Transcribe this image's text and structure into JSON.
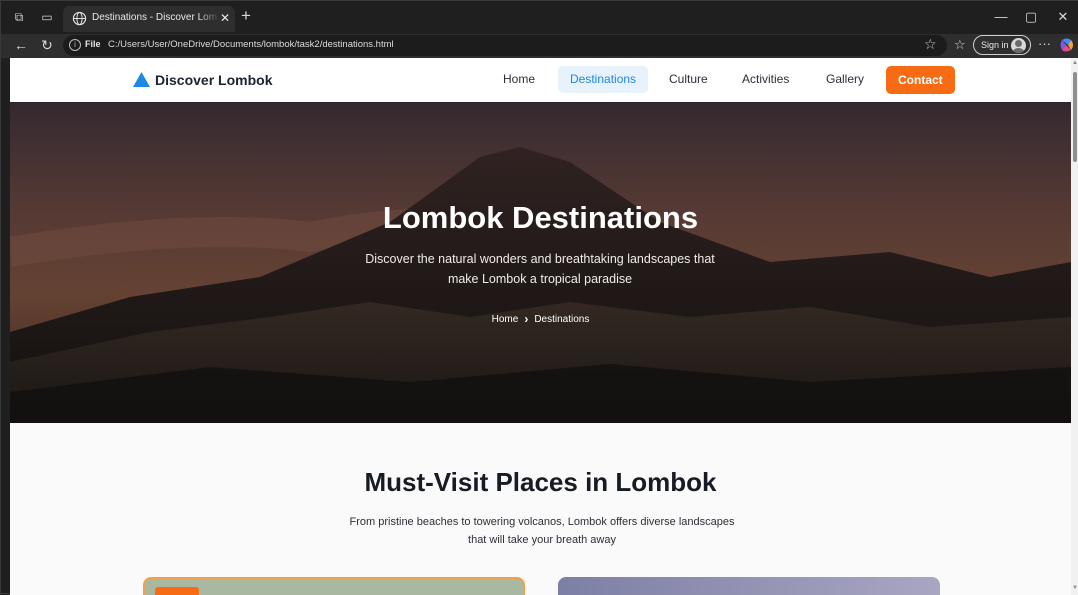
{
  "browser": {
    "tab_title": "Destinations - Discover Lombok",
    "address_scheme": "File",
    "address_url": "C:/Users/User/OneDrive/Documents/lombok/task2/destinations.html",
    "signin_label": "Sign in"
  },
  "site": {
    "brand": "Discover Lombok",
    "nav": [
      {
        "label": "Home"
      },
      {
        "label": "Destinations",
        "active": true
      },
      {
        "label": "Culture"
      },
      {
        "label": "Activities"
      },
      {
        "label": "Gallery"
      }
    ],
    "contact_label": "Contact",
    "accent_color": "#1e88e5",
    "cta_color": "#f76b15"
  },
  "hero": {
    "title": "Lombok Destinations",
    "subtitle_line1": "Discover the natural wonders and breathtaking landscapes that",
    "subtitle_line2": "make Lombok a tropical paradise",
    "breadcrumb_home": "Home",
    "breadcrumb_current": "Destinations"
  },
  "section": {
    "title": "Must-Visit Places in Lombok",
    "subtitle_line1": "From pristine beaches to towering volcanos, Lombok offers diverse landscapes",
    "subtitle_line2": "that will take your breath away"
  }
}
